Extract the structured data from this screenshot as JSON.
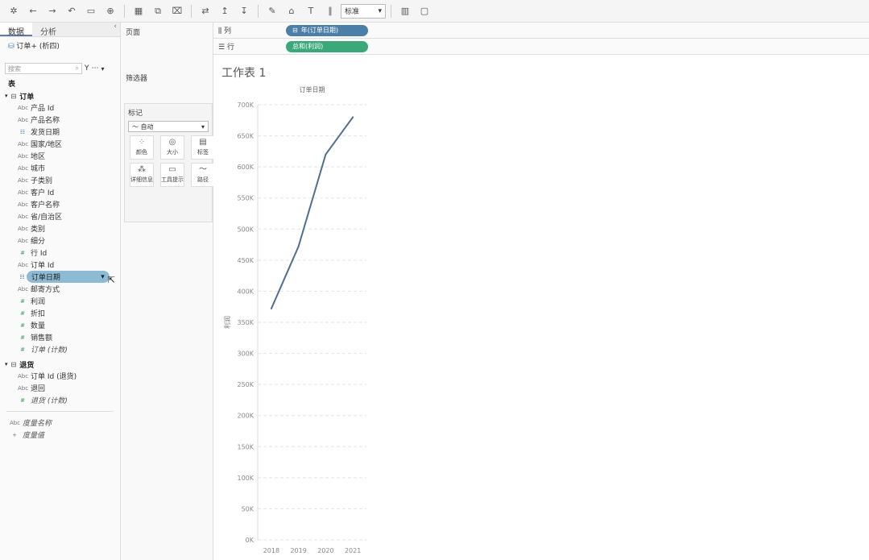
{
  "toolbar": {
    "items": [
      "undo-icon",
      "redo-icon",
      "save-icon",
      "new-datasource-icon",
      "new-worksheet-icon",
      "duplicate-icon",
      "clear-icon",
      "swap-icon",
      "sort-asc-icon",
      "sort-desc-icon",
      "highlight-icon",
      "group-icon",
      "label-icon",
      "fix-axes-icon"
    ],
    "fit_value": "标准",
    "chart_icon": "show-me-icon"
  },
  "data_pane": {
    "tabs": [
      "数据",
      "分析"
    ],
    "datasource": "订单+ (析四)",
    "search_placeholder": "搜索",
    "section_title": "表",
    "tables": [
      {
        "name": "订单",
        "fields": [
          {
            "name": "产品 Id",
            "type": "Abc"
          },
          {
            "name": "产品名称",
            "type": "Abc"
          },
          {
            "name": "发货日期",
            "type": "date"
          },
          {
            "name": "国家/地区",
            "type": "Abc"
          },
          {
            "name": "地区",
            "type": "Abc"
          },
          {
            "name": "城市",
            "type": "Abc"
          },
          {
            "name": "子类别",
            "type": "Abc"
          },
          {
            "name": "客户 Id",
            "type": "Abc"
          },
          {
            "name": "客户名称",
            "type": "Abc"
          },
          {
            "name": "省/自治区",
            "type": "Abc"
          },
          {
            "name": "类别",
            "type": "Abc"
          },
          {
            "name": "细分",
            "type": "Abc"
          },
          {
            "name": "行 Id",
            "type": "#"
          },
          {
            "name": "订单 Id",
            "type": "Abc"
          },
          {
            "name": "订单日期",
            "type": "date",
            "highlighted": true
          },
          {
            "name": "邮寄方式",
            "type": "Abc"
          },
          {
            "name": "利润",
            "type": "#"
          },
          {
            "name": "折扣",
            "type": "#"
          },
          {
            "name": "数量",
            "type": "#"
          },
          {
            "name": "销售额",
            "type": "#"
          },
          {
            "name": "订单 (计数)",
            "type": "#",
            "italic": true
          }
        ]
      },
      {
        "name": "退货",
        "fields": [
          {
            "name": "订单 Id (退货)",
            "type": "Abc"
          },
          {
            "name": "退回",
            "type": "Abc"
          },
          {
            "name": "退货 (计数)",
            "type": "#",
            "italic": true
          }
        ]
      }
    ],
    "extras": [
      {
        "name": "度量名称",
        "type": "Abc",
        "italic": true
      },
      {
        "name": "度量值",
        "type": "+",
        "italic": true
      }
    ]
  },
  "shelves": {
    "pages_label": "页面",
    "filters_label": "筛选器",
    "marks_label": "标记",
    "marks_type": "自动",
    "marks_buttons": [
      {
        "label": "颜色",
        "icon": "color-icon"
      },
      {
        "label": "大小",
        "icon": "size-icon"
      },
      {
        "label": "标签",
        "icon": "label-icon"
      },
      {
        "label": "详细信息",
        "icon": "detail-icon"
      },
      {
        "label": "工具提示",
        "icon": "tooltip-icon"
      },
      {
        "label": "路径",
        "icon": "path-icon"
      }
    ],
    "columns_label": "列",
    "columns_pill": "年(订单日期)",
    "rows_label": "行",
    "rows_pill": "总和(利润)"
  },
  "worksheet": {
    "title": "工作表 1"
  },
  "chart_data": {
    "type": "line",
    "title": "订单日期",
    "xlabel": "订单日期",
    "ylabel": "利润",
    "categories": [
      "2018",
      "2019",
      "2020",
      "2021"
    ],
    "series": [
      {
        "values": [
          372000,
          472000,
          620000,
          680000
        ]
      }
    ],
    "ylim": [
      0,
      700000
    ],
    "yticks": [
      0,
      50000,
      100000,
      150000,
      200000,
      250000,
      300000,
      350000,
      400000,
      450000,
      500000,
      550000,
      600000,
      650000,
      700000
    ],
    "ytick_labels": [
      "0K",
      "50K",
      "100K",
      "150K",
      "200K",
      "250K",
      "300K",
      "350K",
      "400K",
      "450K",
      "500K",
      "550K",
      "600K",
      "650K",
      "700K"
    ],
    "grid": true,
    "line_color": "#4e6e92"
  }
}
